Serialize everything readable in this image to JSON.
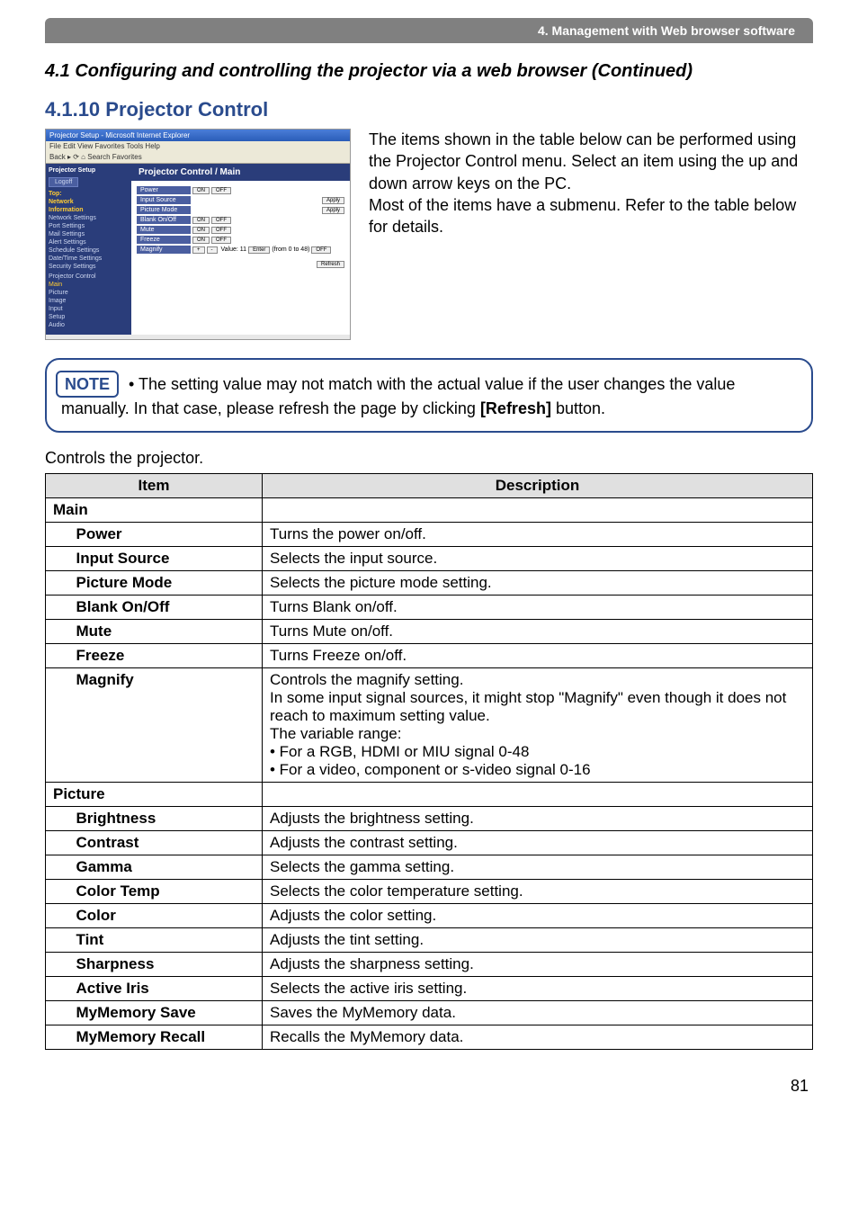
{
  "banner": "4. Management with Web browser software",
  "section_title": "4.1 Configuring and controlling the projector via a web browser (Continued)",
  "subsection_title": "4.1.10 Projector Control",
  "intro_text_1": "The items shown in the table below can be performed using the Projector Control menu. Select an item using the up and down arrow keys on the PC.",
  "intro_text_2": "Most of the items have a submenu. Refer to the table below for details.",
  "note_label": "NOTE",
  "note_bullet": " • The setting value may not match with the actual value if the user changes the value manually. In that case, please refresh the page by clicking ",
  "note_refresh": "[Refresh]",
  "note_tail": " button.",
  "subhead": "Controls the projector.",
  "header_item": "Item",
  "header_desc": "Description",
  "sections": {
    "main": {
      "label": "Main",
      "rows": [
        {
          "item": "Power",
          "desc": "Turns the power on/off."
        },
        {
          "item": "Input Source",
          "desc": "Selects the input source."
        },
        {
          "item": "Picture Mode",
          "desc": "Selects the picture mode setting."
        },
        {
          "item": "Blank On/Off",
          "desc": "Turns Blank on/off."
        },
        {
          "item": "Mute",
          "desc": "Turns Mute on/off."
        },
        {
          "item": "Freeze",
          "desc": "Turns Freeze on/off."
        },
        {
          "item": "Magnify",
          "desc": "Controls the magnify setting.\nIn some input signal sources, it might stop \"Magnify\" even though it does not reach to maximum setting value.\nThe variable range:\n• For a RGB, HDMI or MIU signal  0-48\n• For a video, component or s-video signal  0-16"
        }
      ]
    },
    "picture": {
      "label": "Picture",
      "rows": [
        {
          "item": "Brightness",
          "desc": "Adjusts the brightness setting."
        },
        {
          "item": "Contrast",
          "desc": "Adjusts the contrast setting."
        },
        {
          "item": "Gamma",
          "desc": "Selects the gamma setting."
        },
        {
          "item": "Color Temp",
          "desc": "Selects the color temperature setting."
        },
        {
          "item": "Color",
          "desc": "Adjusts the color setting."
        },
        {
          "item": "Tint",
          "desc": "Adjusts the tint setting."
        },
        {
          "item": "Sharpness",
          "desc": "Adjusts the sharpness setting."
        },
        {
          "item": "Active Iris",
          "desc": "Selects the active iris setting."
        },
        {
          "item": "MyMemory Save",
          "desc": "Saves the MyMemory data."
        },
        {
          "item": "MyMemory Recall",
          "desc": "Recalls the MyMemory data."
        }
      ]
    }
  },
  "screenshot": {
    "titlebar": "Projector Setup - Microsoft Internet Explorer",
    "menubar": "File  Edit  View  Favorites  Tools  Help",
    "toolbar": "Back  ▸  ⟳  ⌂  Search  Favorites",
    "sidebar": {
      "logoff": "Logoff",
      "header_top": "Top:",
      "header_network": "Network",
      "header_info": "Information",
      "items": [
        "Network Settings",
        "Port Settings",
        "Mail Settings",
        "Alert Settings",
        "Schedule Settings",
        "Date/Time Settings",
        "Security Settings"
      ],
      "pc_header": "Projector Control",
      "pc_items": [
        "Main",
        "Picture",
        "Image",
        "Input",
        "Setup",
        "Audio"
      ]
    },
    "main_header": "Projector Control / Main",
    "rows": [
      {
        "label": "Power",
        "btns": [
          "ON",
          "OFF"
        ]
      },
      {
        "label": "Input Source",
        "btns": [
          "Apply"
        ]
      },
      {
        "label": "Picture Mode",
        "btns": [
          "Apply"
        ]
      },
      {
        "label": "Blank On/Off",
        "btns": [
          "ON",
          "OFF"
        ]
      },
      {
        "label": "Mute",
        "btns": [
          "ON",
          "OFF"
        ]
      },
      {
        "label": "Freeze",
        "btns": [
          "ON",
          "OFF"
        ]
      },
      {
        "label": "Magnify",
        "btns": [
          "+",
          "-",
          "Enter",
          "OFF"
        ]
      }
    ],
    "refresh_btn": "Refresh"
  },
  "page_number": "81"
}
